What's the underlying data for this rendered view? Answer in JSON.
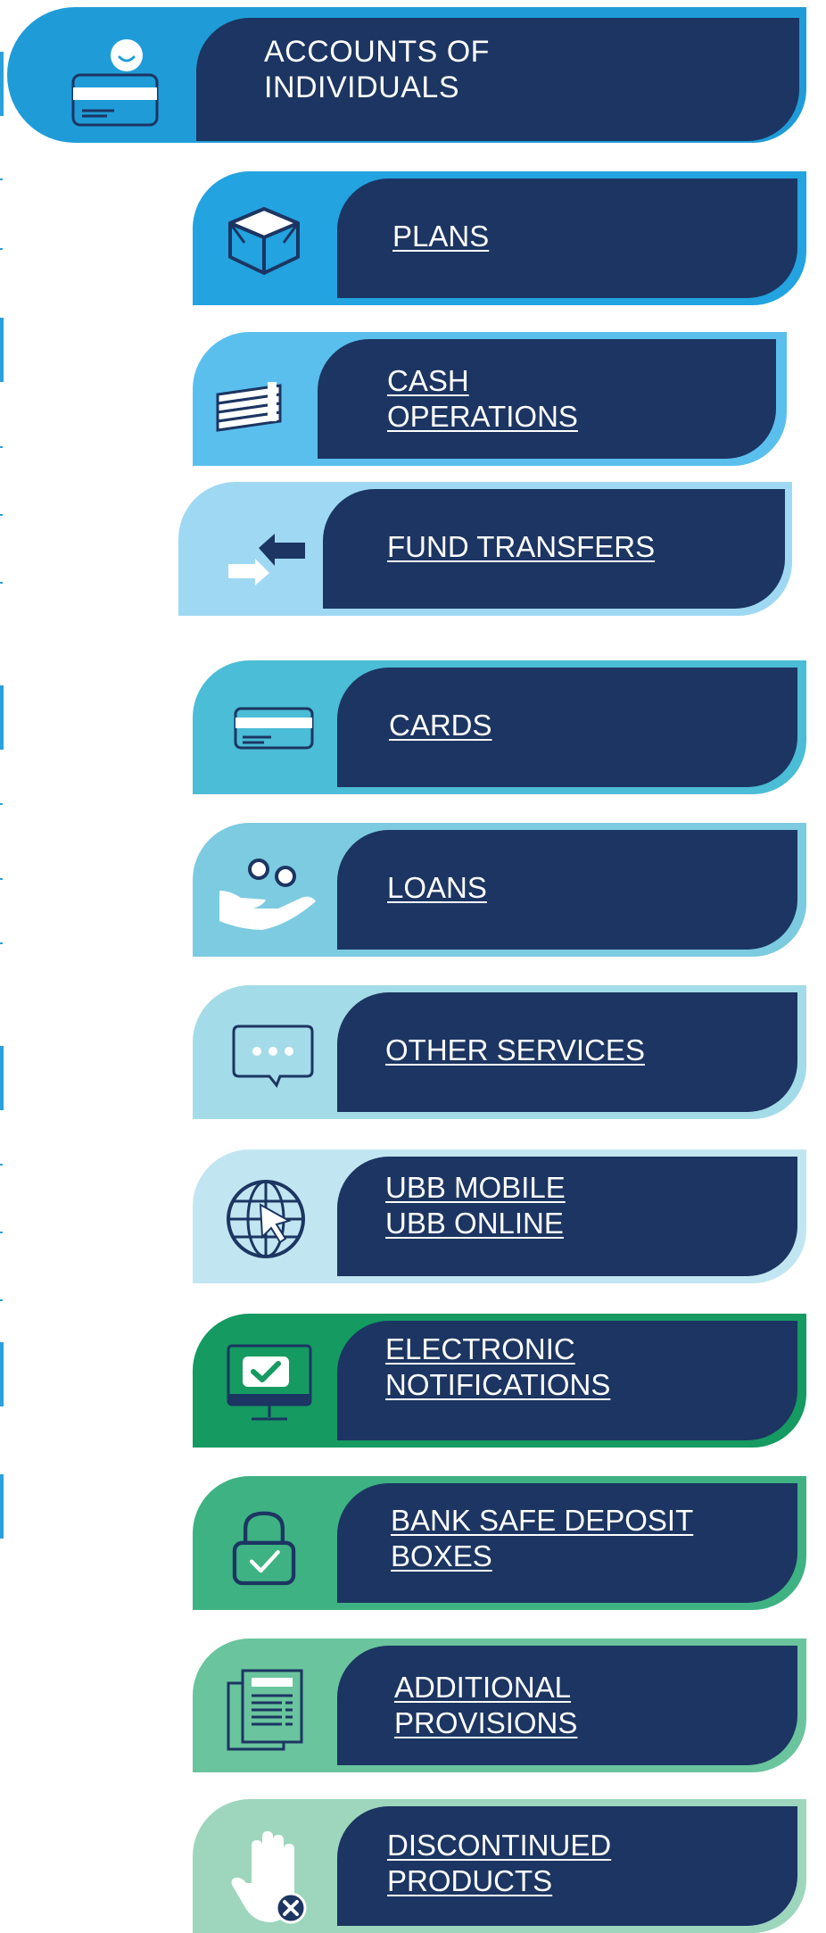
{
  "header": {
    "title_line1": "ACCOUNTS OF",
    "title_line2": "INDIVIDUALS",
    "icon": "account-holder-card-icon"
  },
  "menu": {
    "items": [
      {
        "line1": "PLANS",
        "line2": "",
        "icon": "box-icon",
        "color": "#23a3e0"
      },
      {
        "line1": "CASH",
        "line2": "OPERATIONS",
        "icon": "cash-stack-icon",
        "color": "#5bbfee"
      },
      {
        "line1": "FUND TRANSFERS",
        "line2": "",
        "icon": "transfer-arrows-icon",
        "color": "#9fd8f3"
      },
      {
        "line1": "CARDS",
        "line2": "",
        "icon": "card-icon",
        "color": "#4bbdd6"
      },
      {
        "line1": "LOANS",
        "line2": "",
        "icon": "hand-coins-icon",
        "color": "#7ccbe0"
      },
      {
        "line1": "OTHER SERVICES",
        "line2": "",
        "icon": "chat-bubble-icon",
        "color": "#a4dbe8"
      },
      {
        "line1": "UBB MOBILE",
        "line2": "UBB ONLINE",
        "icon": "globe-cursor-icon",
        "color": "#c2e6f1"
      },
      {
        "line1": "ELECTRONIC",
        "line2": "NOTIFICATIONS",
        "icon": "monitor-check-icon",
        "color": "#159a61"
      },
      {
        "line1": "BANK SAFE DEPOSIT",
        "line2": "BOXES",
        "icon": "padlock-check-icon",
        "color": "#3fb283"
      },
      {
        "line1": "ADDITIONAL",
        "line2": "PROVISIONS",
        "icon": "documents-icon",
        "color": "#6ac49d"
      },
      {
        "line1": "DISCONTINUED",
        "line2": "PRODUCTS",
        "icon": "hand-stop-icon",
        "color": "#9dd6bd"
      }
    ]
  },
  "colors": {
    "navy": "#1c3562",
    "header_blue": "#1f9cd8"
  }
}
